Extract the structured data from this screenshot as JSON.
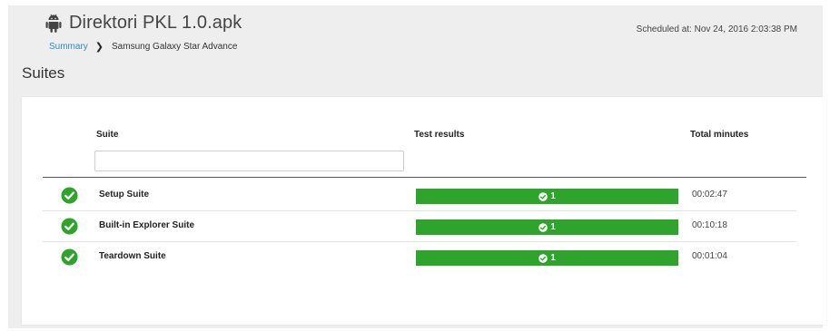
{
  "header": {
    "app_icon": "android-icon",
    "title": "Direktori PKL 1.0.apk",
    "scheduled": "Scheduled at: Nov 24, 2016 2:03:38 PM"
  },
  "breadcrumb": {
    "root": "Summary",
    "current": "Samsung Galaxy Star Advance"
  },
  "section_title": "Suites",
  "table": {
    "columns": {
      "suite": "Suite",
      "results": "Test results",
      "minutes": "Total minutes"
    },
    "filter": {
      "value": "",
      "placeholder": ""
    },
    "rows": [
      {
        "status_icon": "check-circle-icon",
        "name": "Setup Suite",
        "passed": "1",
        "minutes": "00:02:47"
      },
      {
        "status_icon": "check-circle-icon",
        "name": "Built-in Explorer Suite",
        "passed": "1",
        "minutes": "00:10:18"
      },
      {
        "status_icon": "check-circle-icon",
        "name": "Teardown Suite",
        "passed": "1",
        "minutes": "00:01:04"
      }
    ]
  },
  "colors": {
    "pass_green": "#2ea42c",
    "link_blue": "#2b8cc4"
  }
}
